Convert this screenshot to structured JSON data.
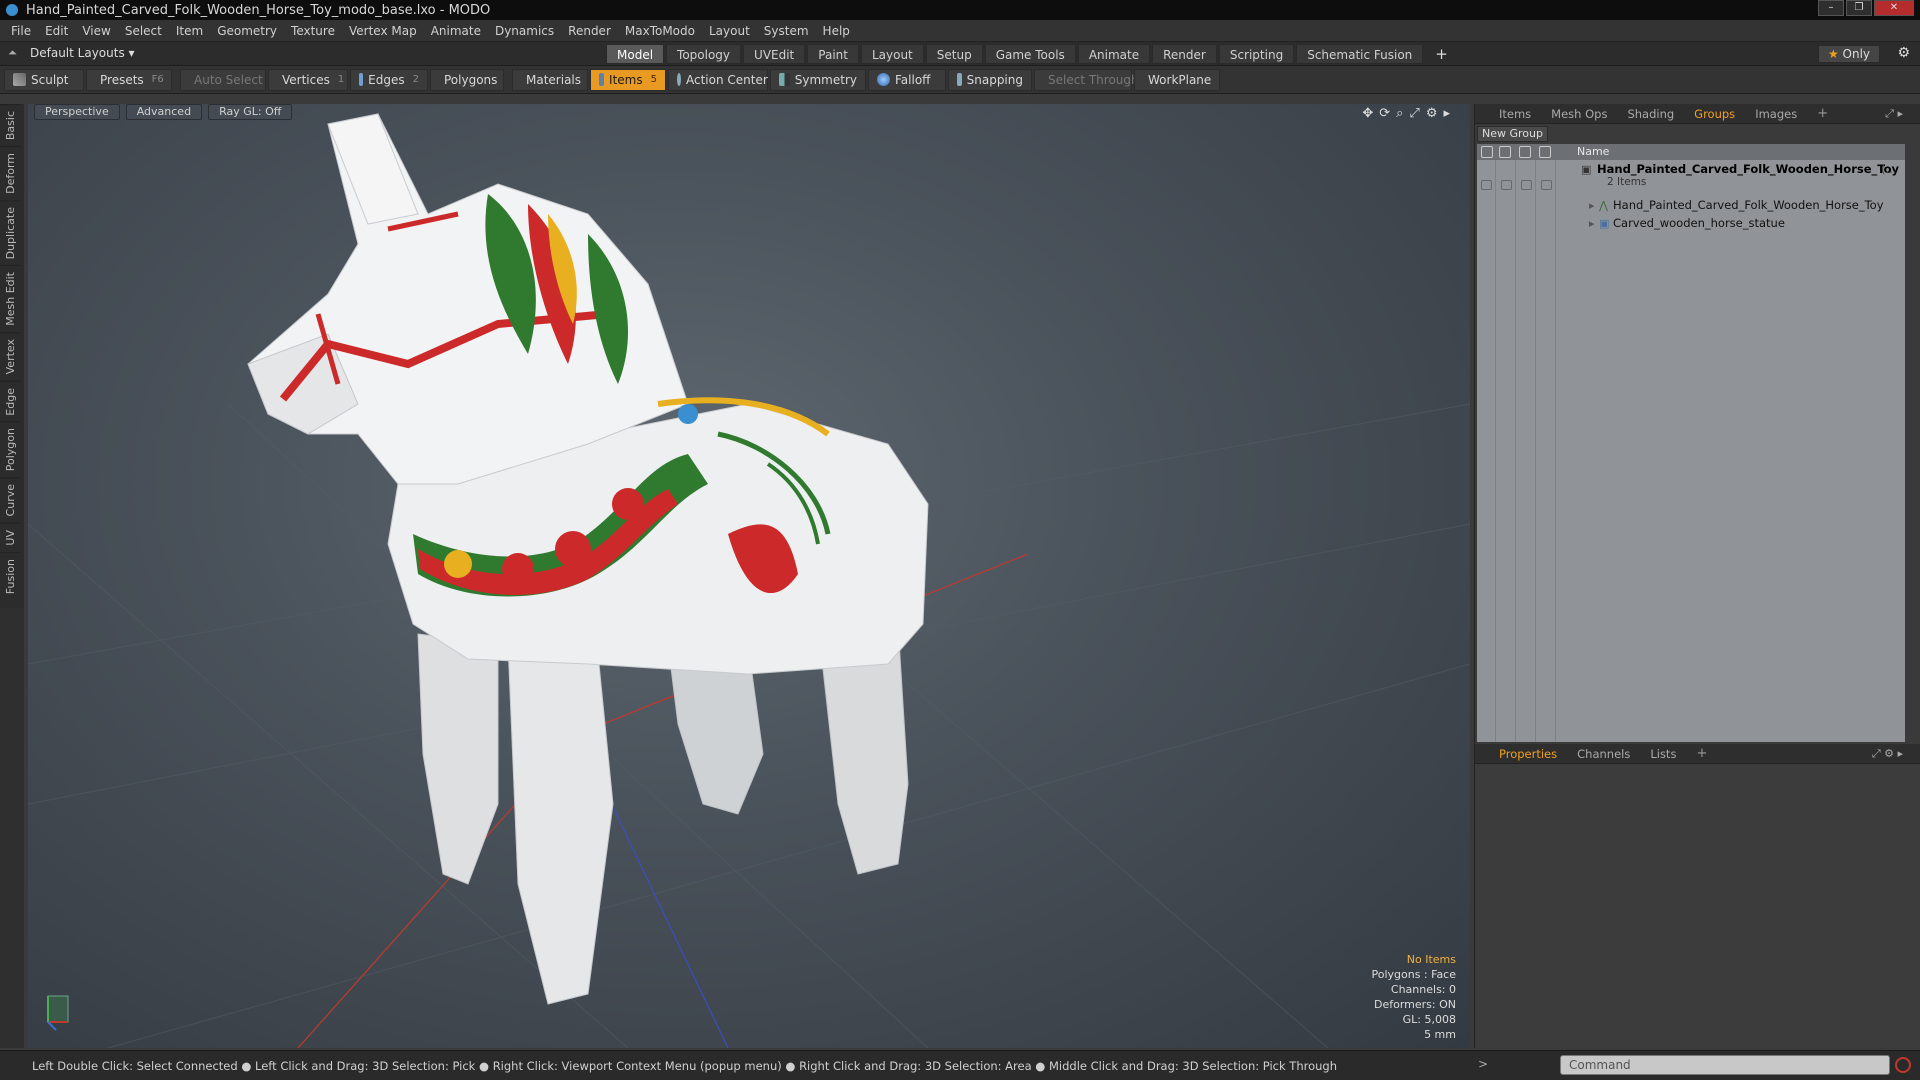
{
  "window": {
    "title": "Hand_Painted_Carved_Folk_Wooden_Horse_Toy_modo_base.lxo - MODO",
    "controls": [
      "–",
      "❐",
      "✕"
    ]
  },
  "menu": [
    "File",
    "Edit",
    "View",
    "Select",
    "Item",
    "Geometry",
    "Texture",
    "Vertex Map",
    "Animate",
    "Dynamics",
    "Render",
    "MaxToModo",
    "Layout",
    "System",
    "Help"
  ],
  "layout_selector": "Default Layouts ▾",
  "mode_tabs": [
    "Model",
    "Topology",
    "UVEdit",
    "Paint",
    "Layout",
    "Setup",
    "Game Tools",
    "Animate",
    "Render",
    "Scripting",
    "Schematic Fusion"
  ],
  "mode_tab_add": "+",
  "only_button": {
    "star": "★",
    "label": "Only"
  },
  "toolbar": {
    "sculpt": "Sculpt",
    "presets": "Presets",
    "presets_key": "F6",
    "auto_select": "Auto Select",
    "vertices": "Vertices",
    "vertices_count": "1",
    "edges": "Edges",
    "edges_count": "2",
    "polygons": "Polygons",
    "materials": "Materials",
    "items": "Items",
    "items_count": "5",
    "action_center": "Action Center",
    "symmetry": "Symmetry",
    "falloff": "Falloff",
    "snapping": "Snapping",
    "select_through": "Select Through",
    "workplane": "WorkPlane"
  },
  "left_tabs": [
    "Basic",
    "Deform",
    "Duplicate",
    "Mesh Edit",
    "Vertex",
    "Edge",
    "Polygon",
    "Curve",
    "UV",
    "Fusion"
  ],
  "viewport": {
    "view": "Perspective",
    "shading": "Advanced",
    "raygl": "Ray GL: Off",
    "info": {
      "selection": "No Items",
      "polygons": "Polygons : Face",
      "channels": "Channels: 0",
      "deformers": "Deformers: ON",
      "gl": "GL: 5,008",
      "scale": "5 mm"
    }
  },
  "status_bar": "Left Double Click: Select Connected ● Left Click and Drag: 3D Selection: Pick ● Right Click: Viewport Context Menu (popup menu) ● Right Click and Drag: 3D Selection: Area ● Middle Click and Drag: 3D Selection: Pick Through",
  "groups_panel": {
    "tabs": [
      "Items",
      "Mesh Ops",
      "Shading",
      "Groups",
      "Images"
    ],
    "active_tab": "Groups",
    "add": "+",
    "new_group": "New Group",
    "name_header": "Name",
    "group": {
      "name": "Hand_Painted_Carved_Folk_Wooden_Horse_Toy",
      "suffix": "(...",
      "count": "2 Items",
      "children": [
        "Hand_Painted_Carved_Folk_Wooden_Horse_Toy",
        "Carved_wooden_horse_statue"
      ]
    }
  },
  "properties_panel": {
    "tabs": [
      "Properties",
      "Channels",
      "Lists"
    ],
    "active_tab": "Properties",
    "add": "+"
  },
  "command": {
    "placeholder": "Command"
  },
  "colors": {
    "accent": "#f0a020",
    "items_active": "#e89a22",
    "horse_red": "#cc2a2a",
    "horse_green": "#2f7a2f",
    "horse_yellow": "#e8b020"
  }
}
